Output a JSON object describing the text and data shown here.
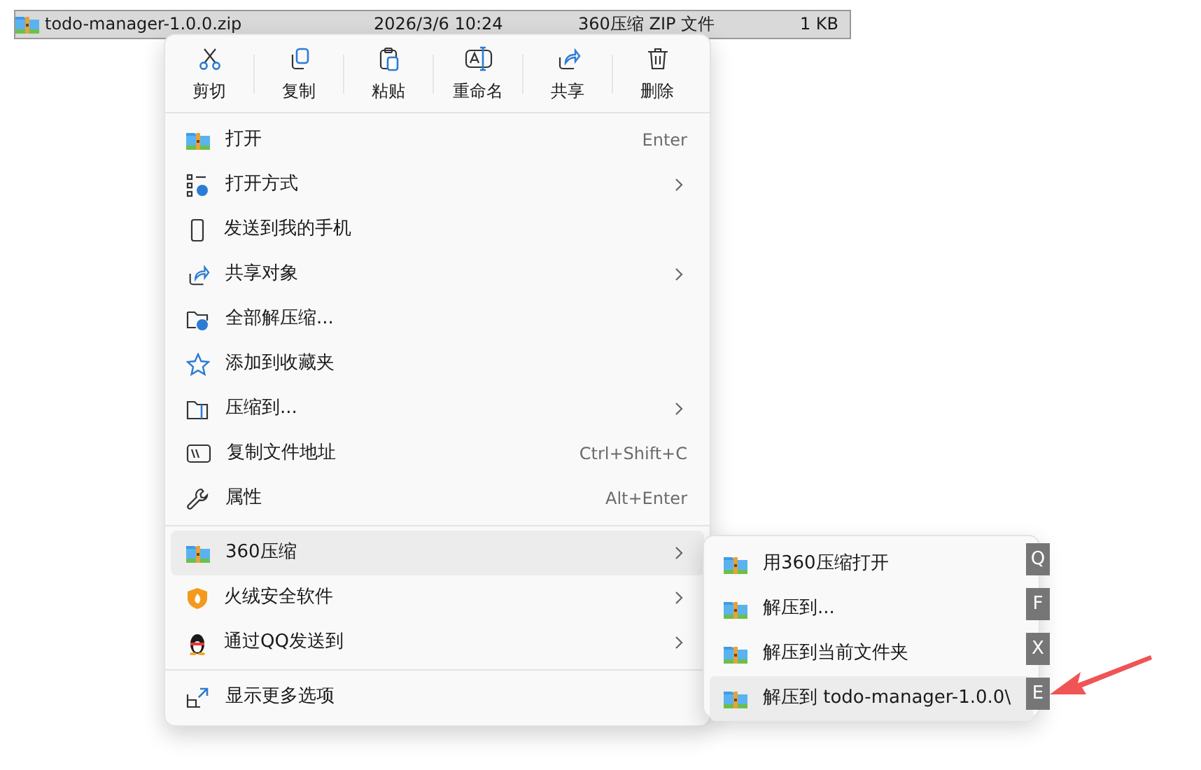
{
  "file_row": {
    "name": "todo-manager-1.0.0.zip",
    "date": "2026/3/6 10:24",
    "type": "360压缩 ZIP 文件",
    "size": "1 KB",
    "selected": true
  },
  "toolbar": [
    {
      "label": "剪切"
    },
    {
      "label": "复制"
    },
    {
      "label": "粘贴"
    },
    {
      "label": "重命名"
    },
    {
      "label": "共享"
    },
    {
      "label": "删除"
    }
  ],
  "menu_groups": [
    [
      {
        "label": "打开",
        "shortcut": "Enter",
        "submenu": false,
        "selected": false
      },
      {
        "label": "打开方式",
        "submenu": true,
        "selected": false
      },
      {
        "label": "发送到我的手机",
        "submenu": false,
        "selected": false
      },
      {
        "label": "共享对象",
        "submenu": true,
        "selected": false
      },
      {
        "label": "全部解压缩...",
        "submenu": false,
        "selected": false
      },
      {
        "label": "添加到收藏夹",
        "submenu": false,
        "selected": false
      },
      {
        "label": "压缩到...",
        "submenu": true,
        "selected": false
      },
      {
        "label": "复制文件地址",
        "shortcut": "Ctrl+Shift+C",
        "submenu": false,
        "selected": false
      },
      {
        "label": "属性",
        "shortcut": "Alt+Enter",
        "submenu": false,
        "selected": false
      }
    ],
    [
      {
        "label": "360压缩",
        "submenu": true,
        "selected": true
      },
      {
        "label": "火绒安全软件",
        "submenu": true,
        "selected": false
      },
      {
        "label": "通过QQ发送到",
        "submenu": true,
        "selected": false
      }
    ],
    [
      {
        "label": "显示更多选项",
        "submenu": false,
        "selected": false
      }
    ]
  ],
  "submenu": [
    {
      "label": "用360压缩打开",
      "key": "Q",
      "selected": false
    },
    {
      "label": "解压到...",
      "key": "F",
      "selected": false
    },
    {
      "label": "解压到当前文件夹",
      "key": "X",
      "selected": false
    },
    {
      "label": "解压到 todo-manager-1.0.0\\",
      "key": "E",
      "selected": true
    }
  ]
}
